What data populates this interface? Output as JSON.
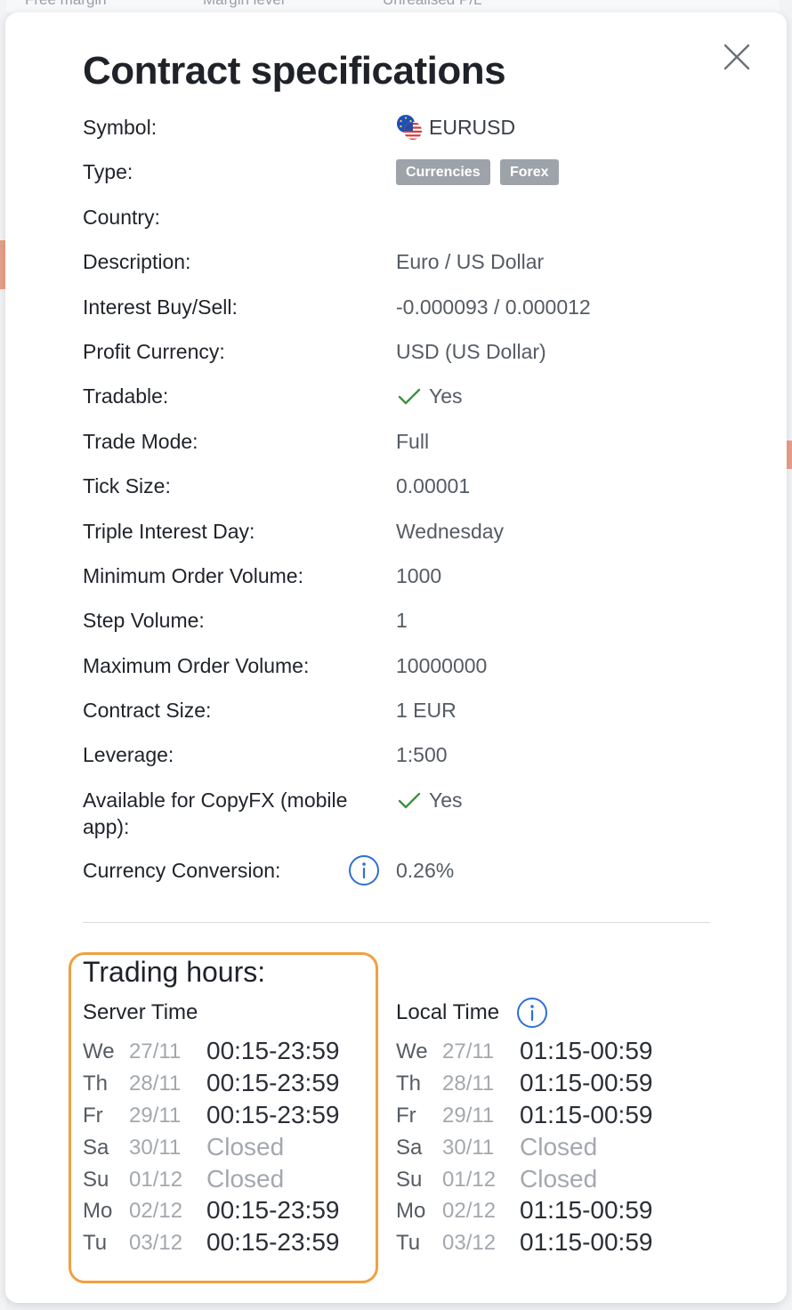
{
  "background": {
    "labels": [
      "Free margin",
      "Margin level",
      "Unrealised P/L"
    ]
  },
  "dialog": {
    "title": "Contract specifications",
    "close_icon": "close-icon"
  },
  "specs": {
    "symbol": {
      "label": "Symbol:",
      "value": "EURUSD",
      "icon": "eu-us-flag-icon"
    },
    "type": {
      "label": "Type:",
      "tags": [
        "Currencies",
        "Forex"
      ]
    },
    "country": {
      "label": "Country:",
      "value": ""
    },
    "description": {
      "label": "Description:",
      "value": "Euro / US Dollar"
    },
    "interest": {
      "label": "Interest Buy/Sell:",
      "value": "-0.000093 / 0.000012"
    },
    "profit_currency": {
      "label": "Profit Currency:",
      "value": "USD (US Dollar)"
    },
    "tradable": {
      "label": "Tradable:",
      "value": "Yes",
      "icon": "check-icon"
    },
    "trade_mode": {
      "label": "Trade Mode:",
      "value": "Full"
    },
    "tick_size": {
      "label": "Tick Size:",
      "value": "0.00001"
    },
    "triple_interest_day": {
      "label": "Triple Interest Day:",
      "value": "Wednesday"
    },
    "min_order_volume": {
      "label": "Minimum Order Volume:",
      "value": "1000"
    },
    "step_volume": {
      "label": "Step Volume:",
      "value": "1"
    },
    "max_order_volume": {
      "label": "Maximum Order Volume:",
      "value": "10000000"
    },
    "contract_size": {
      "label": "Contract Size:",
      "value": "1 EUR"
    },
    "leverage": {
      "label": "Leverage:",
      "value": "1:500"
    },
    "copyfx": {
      "label": "Available for CopyFX (mobile app):",
      "value": "Yes",
      "icon": "check-icon"
    },
    "currency_conversion": {
      "label": "Currency Conversion:",
      "value": "0.26%",
      "icon": "info-icon"
    }
  },
  "trading_hours": {
    "title": "Trading hours:",
    "server": {
      "heading": "Server Time",
      "rows": [
        {
          "day": "We",
          "date": "27/11",
          "time": "00:15-23:59"
        },
        {
          "day": "Th",
          "date": "28/11",
          "time": "00:15-23:59"
        },
        {
          "day": "Fr",
          "date": "29/11",
          "time": "00:15-23:59"
        },
        {
          "day": "Sa",
          "date": "30/11",
          "time": "Closed"
        },
        {
          "day": "Su",
          "date": "01/12",
          "time": "Closed"
        },
        {
          "day": "Mo",
          "date": "02/12",
          "time": "00:15-23:59"
        },
        {
          "day": "Tu",
          "date": "03/12",
          "time": "00:15-23:59"
        }
      ]
    },
    "local": {
      "heading": "Local Time",
      "icon": "info-icon",
      "rows": [
        {
          "day": "We",
          "date": "27/11",
          "time": "01:15-00:59"
        },
        {
          "day": "Th",
          "date": "28/11",
          "time": "01:15-00:59"
        },
        {
          "day": "Fr",
          "date": "29/11",
          "time": "01:15-00:59"
        },
        {
          "day": "Sa",
          "date": "30/11",
          "time": "Closed"
        },
        {
          "day": "Su",
          "date": "01/12",
          "time": "Closed"
        },
        {
          "day": "Mo",
          "date": "02/12",
          "time": "01:15-00:59"
        },
        {
          "day": "Tu",
          "date": "03/12",
          "time": "01:15-00:59"
        }
      ]
    }
  },
  "colors": {
    "highlight_border": "#f0a040",
    "check": "#3f9142",
    "info": "#2f6fd6",
    "tag_bg": "#9ea3aa"
  }
}
